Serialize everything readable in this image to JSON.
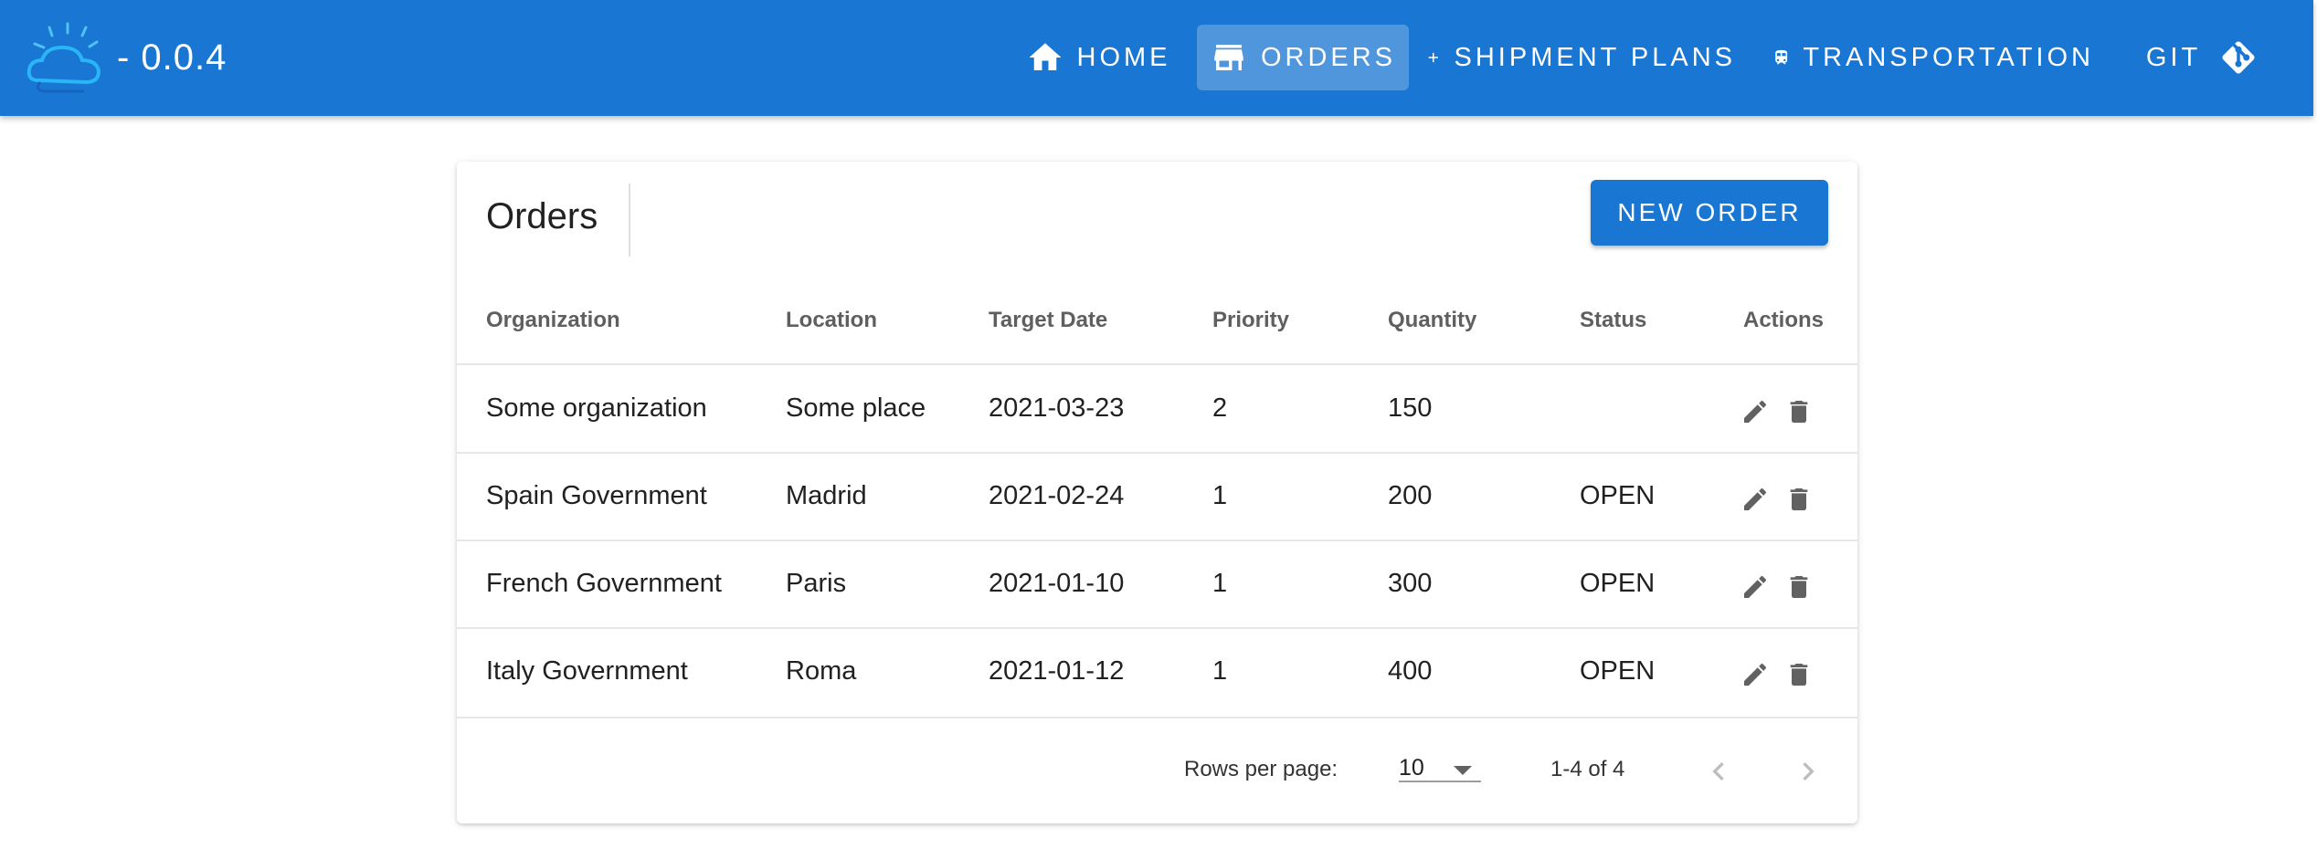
{
  "app": {
    "version": "- 0.0.4",
    "logo_icon": "ibm-cloud-icon"
  },
  "nav": [
    {
      "label": "HOME",
      "icon": "home-icon",
      "active": false
    },
    {
      "label": "ORDERS",
      "icon": "store-icon",
      "active": true
    },
    {
      "label": "SHIPMENT PLANS",
      "icon": "plus-icon",
      "active": false
    },
    {
      "label": "TRANSPORTATION",
      "icon": "train-icon",
      "active": false
    },
    {
      "label": "GIT",
      "icon": "git-icon",
      "active": false
    }
  ],
  "orders": {
    "title": "Orders",
    "new_button": "NEW ORDER",
    "columns": [
      "Organization",
      "Location",
      "Target Date",
      "Priority",
      "Quantity",
      "Status",
      "Actions"
    ],
    "rows": [
      [
        "Some organization",
        "Some place",
        "2021-03-23",
        "2",
        "150",
        ""
      ],
      [
        "Spain Government",
        "Madrid",
        "2021-02-24",
        "1",
        "200",
        "OPEN"
      ],
      [
        "French Government",
        "Paris",
        "2021-01-10",
        "1",
        "300",
        "OPEN"
      ],
      [
        "Italy Government",
        "Roma",
        "2021-01-12",
        "1",
        "400",
        "OPEN"
      ]
    ],
    "row_actions": [
      "edit-icon",
      "delete-icon"
    ]
  },
  "pagination": {
    "rows_per_page_label": "Rows per page:",
    "rows_per_page_value": "10",
    "range": "1-4 of 4"
  },
  "colors": {
    "primary": "#1976d2",
    "icon_gray": "#616161"
  }
}
